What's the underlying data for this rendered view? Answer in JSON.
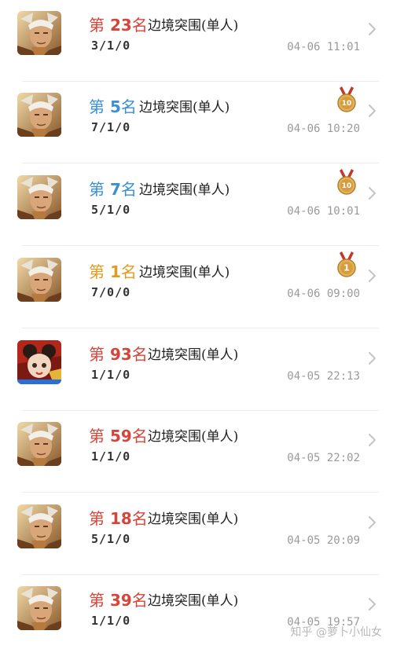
{
  "colors": {
    "rank_red": "#d6453a",
    "rank_blue": "#3a8fd6",
    "rank_gold": "#e39b1e",
    "time_gray": "#9a9a9a",
    "medal_gold": "#d4a24a",
    "medal_ribbon": "#c0392b"
  },
  "matches": [
    {
      "rank_prefix": "第",
      "rank_num": "23",
      "rank_suffix": "名",
      "rank_color": "red",
      "mode": "边境突围(单人)",
      "kda": "3/1/0",
      "time": "04-06 11:01",
      "medal": "",
      "hero": "warrior"
    },
    {
      "rank_prefix": "第",
      "rank_num": "5",
      "rank_suffix": "名",
      "rank_color": "blue",
      "mode": "边境突围(单人)",
      "kda": "7/1/0",
      "time": "04-06 10:20",
      "medal": "10",
      "hero": "warrior"
    },
    {
      "rank_prefix": "第",
      "rank_num": "7",
      "rank_suffix": "名",
      "rank_color": "blue",
      "mode": "边境突围(单人)",
      "kda": "5/1/0",
      "time": "04-06 10:01",
      "medal": "10",
      "hero": "warrior"
    },
    {
      "rank_prefix": "第",
      "rank_num": "1",
      "rank_suffix": "名",
      "rank_color": "gold",
      "mode": "边境突围(单人)",
      "kda": "7/0/0",
      "time": "04-06 09:00",
      "medal": "1",
      "hero": "warrior"
    },
    {
      "rank_prefix": "第",
      "rank_num": "93",
      "rank_suffix": "名",
      "rank_color": "red",
      "mode": "边境突围(单人)",
      "kda": "1/1/0",
      "time": "04-05 22:13",
      "medal": "",
      "hero": "girl"
    },
    {
      "rank_prefix": "第",
      "rank_num": "59",
      "rank_suffix": "名",
      "rank_color": "red",
      "mode": "边境突围(单人)",
      "kda": "1/1/0",
      "time": "04-05 22:02",
      "medal": "",
      "hero": "warrior"
    },
    {
      "rank_prefix": "第",
      "rank_num": "18",
      "rank_suffix": "名",
      "rank_color": "red",
      "mode": "边境突围(单人)",
      "kda": "5/1/0",
      "time": "04-05 20:09",
      "medal": "",
      "hero": "warrior"
    },
    {
      "rank_prefix": "第",
      "rank_num": "39",
      "rank_suffix": "名",
      "rank_color": "red",
      "mode": "边境突围(单人)",
      "kda": "1/1/0",
      "time": "04-05 19:57",
      "medal": "",
      "hero": "warrior"
    }
  ],
  "icons": {
    "chevron": "chevron-right-icon",
    "medal": "medal-icon",
    "avatar": "hero-avatar"
  },
  "watermark": "知乎 @萝卜小仙女"
}
